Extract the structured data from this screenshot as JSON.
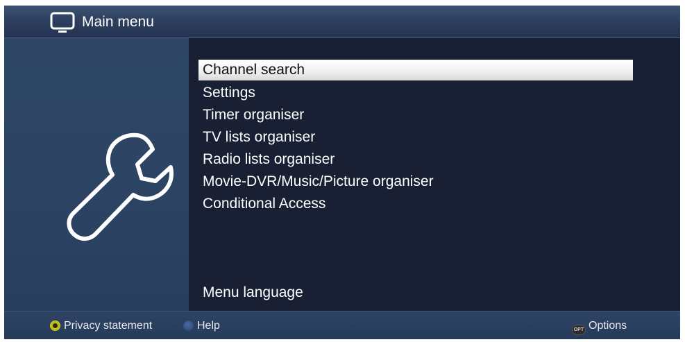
{
  "header": {
    "title": "Main menu",
    "icon": "tv-icon"
  },
  "side_panel": {
    "icon": "wrench-icon"
  },
  "menu": {
    "items": [
      {
        "label": "Channel search",
        "selected": true
      },
      {
        "label": "Settings",
        "selected": false
      },
      {
        "label": "Timer organiser",
        "selected": false
      },
      {
        "label": "TV lists organiser",
        "selected": false
      },
      {
        "label": "Radio lists organiser",
        "selected": false
      },
      {
        "label": "Movie-DVR/Music/Picture organiser",
        "selected": false
      },
      {
        "label": "Conditional Access",
        "selected": false
      }
    ],
    "language_item": {
      "label": "Menu language"
    }
  },
  "footer": {
    "privacy": {
      "label": "Privacy statement",
      "key_color": "yellow"
    },
    "help": {
      "label": "Help",
      "key_color": "blue"
    },
    "options": {
      "label": "Options",
      "key_label": "OPT"
    }
  },
  "colors": {
    "background": "#1a2034",
    "side_panel": "#2f4767",
    "header": "#2e4060",
    "selected_bar": "#eeeeee",
    "text": "#ffffff"
  }
}
